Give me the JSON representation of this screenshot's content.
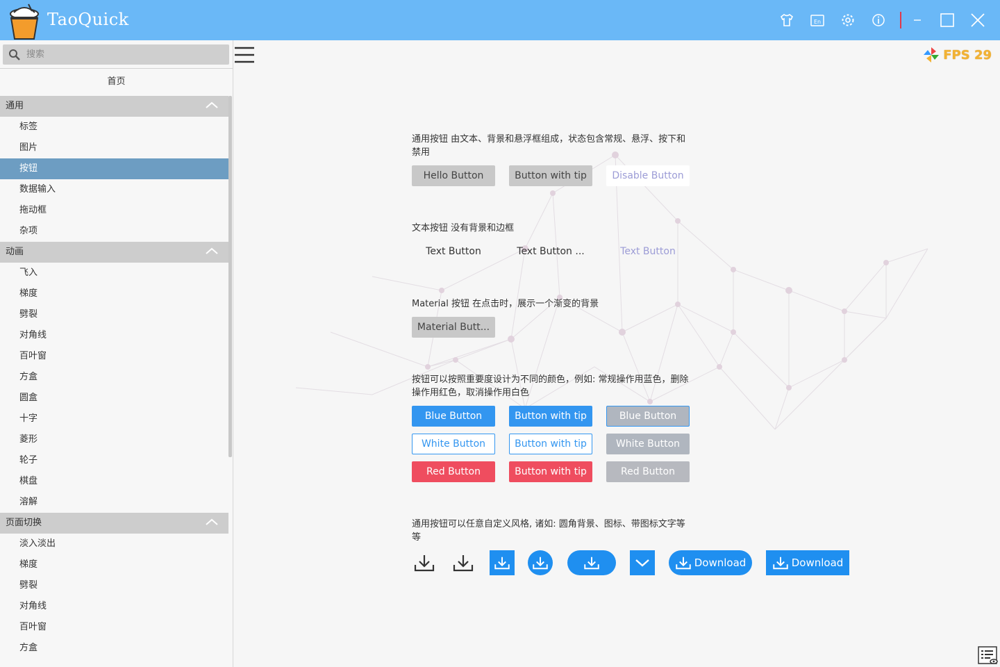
{
  "app": {
    "title": "TaoQuick"
  },
  "titlebar": {
    "icons": [
      "shirt-icon",
      "language-icon",
      "settings-icon",
      "info-icon",
      "minimize-icon",
      "maximize-icon",
      "close-icon"
    ]
  },
  "sidebar": {
    "search_placeholder": "搜索",
    "home_label": "首页",
    "groups": [
      {
        "label": "通用",
        "items": [
          "标签",
          "图片",
          "按钮",
          "数据输入",
          "拖动框",
          "杂项"
        ],
        "active_index": 2
      },
      {
        "label": "动画",
        "items": [
          "飞入",
          "梯度",
          "劈裂",
          "对角线",
          "百叶窗",
          "方盒",
          "圆盒",
          "十字",
          "菱形",
          "轮子",
          "棋盘",
          "溶解"
        ]
      },
      {
        "label": "页面切换",
        "items": [
          "淡入淡出",
          "梯度",
          "劈裂",
          "对角线",
          "百叶窗",
          "方盒"
        ]
      }
    ]
  },
  "header": {
    "fps_label": "FPS 29"
  },
  "sections": {
    "common": {
      "desc": "通用按钮 由文本、背景和悬浮框组成，状态包含常规、悬浮、按下和禁用",
      "buttons": [
        "Hello Button",
        "Button with tip",
        "Disable Button"
      ]
    },
    "text": {
      "desc": "文本按钮 没有背景和边框",
      "buttons": [
        "Text Button",
        "Text Button ...",
        "Text Button"
      ]
    },
    "material": {
      "desc": "Material 按钮 在点击时，展示一个渐变的背景",
      "button": "Material Butt..."
    },
    "colored": {
      "desc": "按钮可以按照重要度设计为不同的颜色，例如: 常规操作用蓝色，删除操作用红色，取消操作用白色",
      "rows": [
        [
          "Blue Button",
          "Button with tip",
          "Blue Button"
        ],
        [
          "White Button",
          "Button with tip",
          "White Button"
        ],
        [
          "Red Button",
          "Button with tip",
          "Red Button"
        ]
      ]
    },
    "custom": {
      "desc": "通用按钮可以任意自定义风格, 诸如: 圆角背景、图标、带图标文字等等",
      "download_label_1": "Download",
      "download_label_2": "Download"
    }
  },
  "colors": {
    "titlebar": "#6ab8f7",
    "accent_blue": "#3396f0",
    "danger_red": "#ef4d5f",
    "active_item": "#6d9dc2"
  }
}
